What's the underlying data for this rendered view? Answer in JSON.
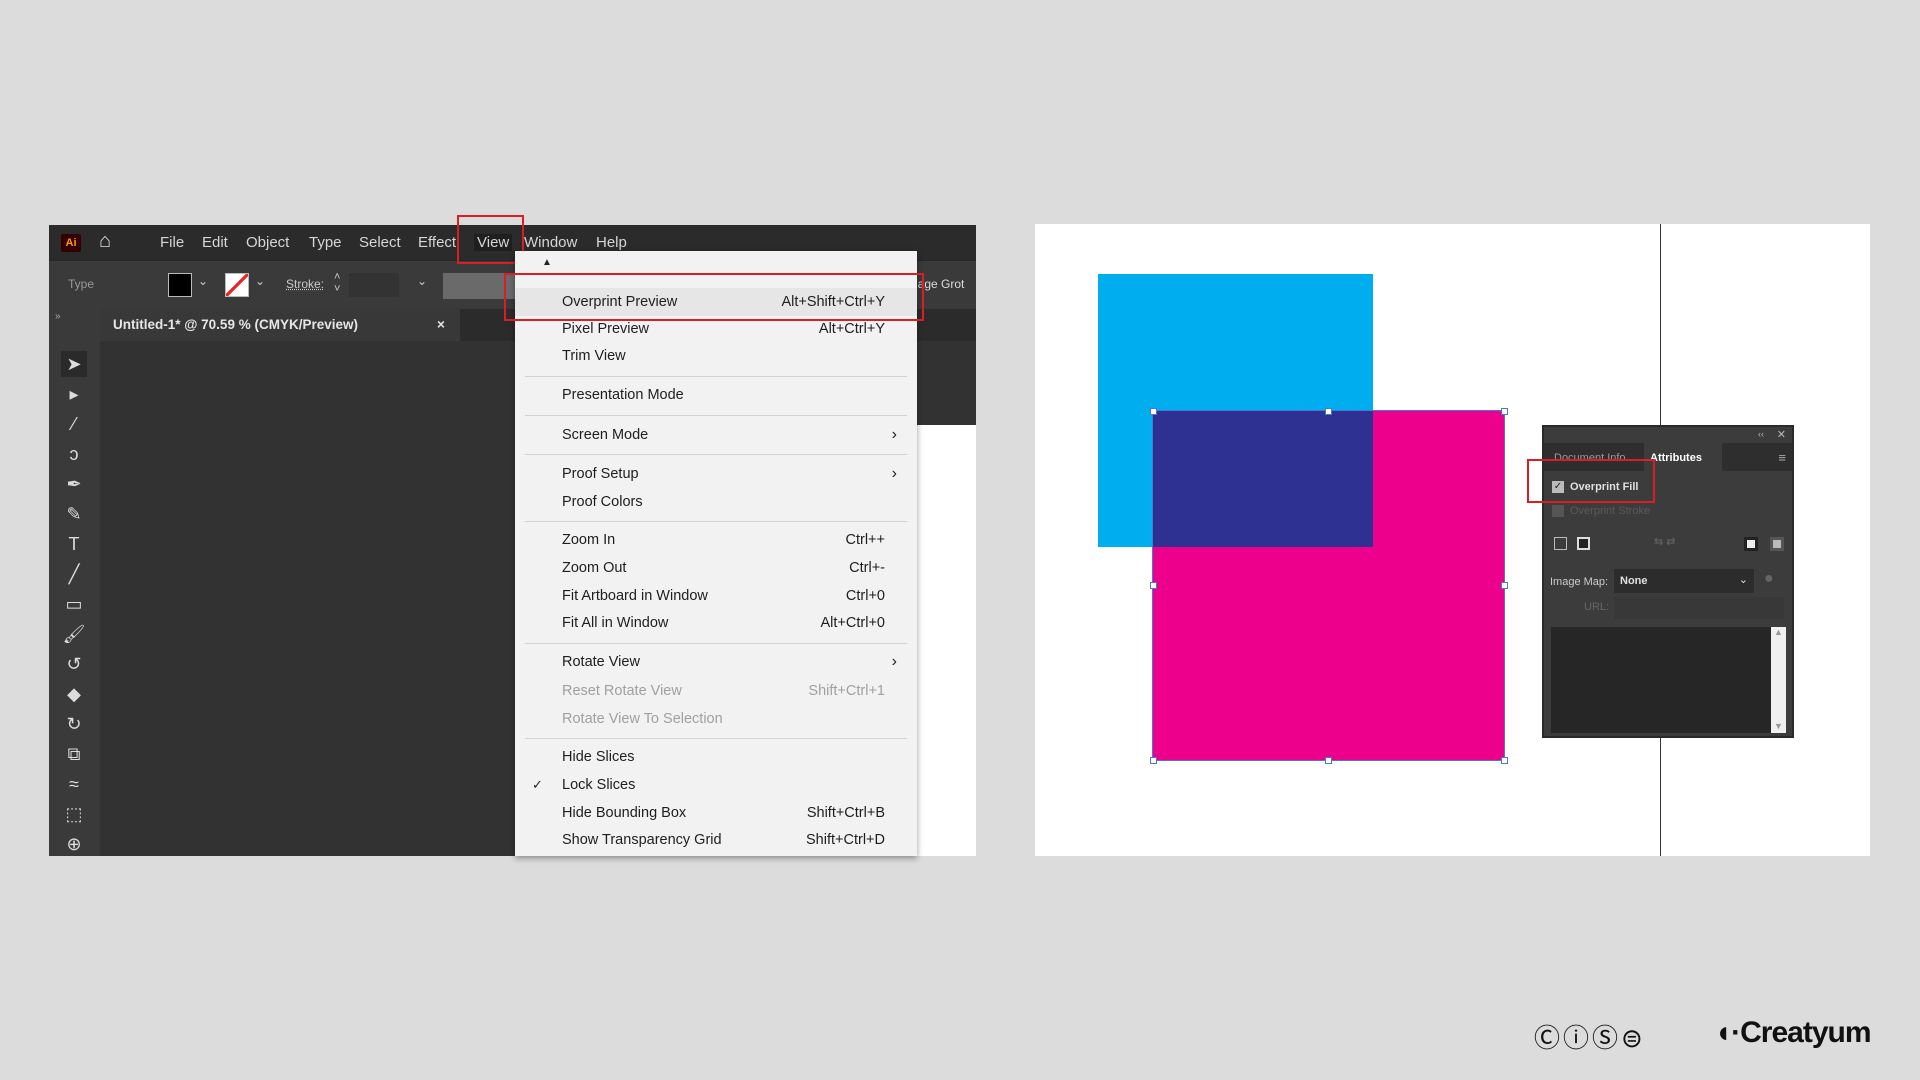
{
  "app": {
    "logo": "Ai",
    "menu": [
      "File",
      "Edit",
      "Object",
      "Type",
      "Select",
      "Effect",
      "View",
      "Window",
      "Help"
    ]
  },
  "control_bar": {
    "mode_label": "Type",
    "stroke_label": "Stroke:",
    "font_partial": "lage Grot"
  },
  "document_tab": {
    "title": "Untitled-1* @ 70.59 % (CMYK/Preview)",
    "close": "×"
  },
  "view_menu": {
    "items": [
      {
        "label": "Overprint Preview",
        "shortcut": "Alt+Shift+Ctrl+Y"
      },
      {
        "label": "Pixel Preview",
        "shortcut": "Alt+Ctrl+Y"
      },
      {
        "label": "Trim View",
        "shortcut": ""
      },
      {
        "label": "Presentation Mode",
        "shortcut": ""
      },
      {
        "label": "Screen Mode",
        "shortcut": "",
        "submenu": true
      },
      {
        "label": "Proof Setup",
        "shortcut": "",
        "submenu": true
      },
      {
        "label": "Proof Colors",
        "shortcut": ""
      },
      {
        "label": "Zoom In",
        "shortcut": "Ctrl++"
      },
      {
        "label": "Zoom Out",
        "shortcut": "Ctrl+-"
      },
      {
        "label": "Fit Artboard in Window",
        "shortcut": "Ctrl+0"
      },
      {
        "label": "Fit All in Window",
        "shortcut": "Alt+Ctrl+0"
      },
      {
        "label": "Rotate View",
        "shortcut": "",
        "submenu": true
      },
      {
        "label": "Reset Rotate View",
        "shortcut": "Shift+Ctrl+1",
        "disabled": true
      },
      {
        "label": "Rotate View To Selection",
        "shortcut": "",
        "disabled": true
      },
      {
        "label": "Hide Slices",
        "shortcut": ""
      },
      {
        "label": "Lock Slices",
        "shortcut": "",
        "checked": true
      },
      {
        "label": "Hide Bounding Box",
        "shortcut": "Shift+Ctrl+B"
      },
      {
        "label": "Show Transparency Grid",
        "shortcut": "Shift+Ctrl+D"
      }
    ]
  },
  "attributes_panel": {
    "tabs": [
      "Document Info",
      "Attributes"
    ],
    "overprint_fill": "Overprint Fill",
    "overprint_fill_checked": true,
    "overprint_stroke": "Overprint Stroke",
    "image_map_label": "Image Map:",
    "image_map_value": "None",
    "url_label": "URL:"
  },
  "colors": {
    "cyan": "#00aeef",
    "magenta": "#ec008c",
    "overlap": "#2e3192",
    "highlight": "#d91e25"
  },
  "footer": {
    "license_icons": [
      "cc",
      "by",
      "nc",
      "nd"
    ],
    "brand": "Creatyum"
  }
}
